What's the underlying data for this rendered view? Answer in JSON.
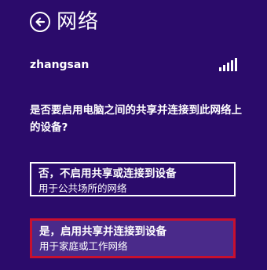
{
  "header": {
    "title": "网络",
    "back_icon": "arrow-left-circle-icon"
  },
  "network": {
    "name": "zhangsan",
    "signal_icon": "signal-bars-icon"
  },
  "question": "是否要启用电脑之间的共享并连接到此网络上的设备?",
  "options": [
    {
      "title": "否，不启用共享或连接到设备",
      "subtitle": "用于公共场所的网络"
    },
    {
      "title": "是，启用共享并连接到设备",
      "subtitle": "用于家庭或工作网络"
    }
  ],
  "colors": {
    "background": "#2b0b6b",
    "selected_border": "#c8102e",
    "selected_fill": "#4a2a8a"
  }
}
